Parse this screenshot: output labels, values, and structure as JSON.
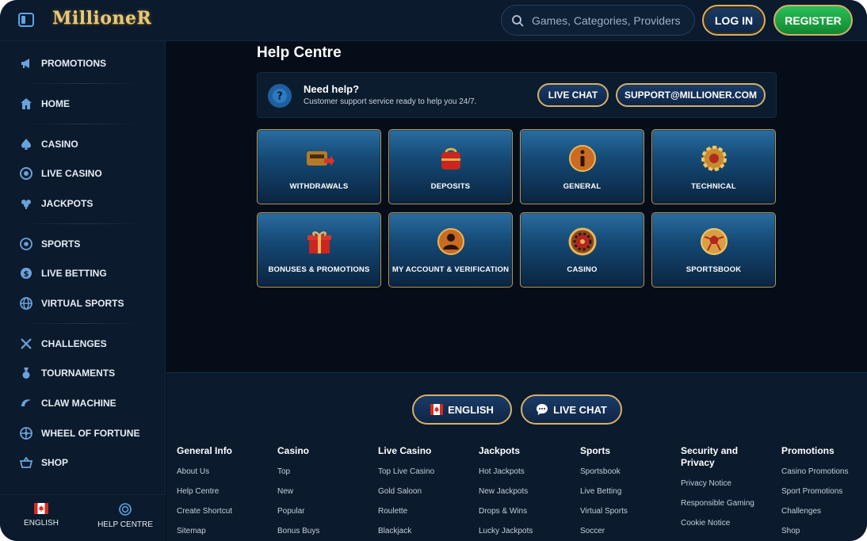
{
  "header": {
    "logo_text": "MillioneR",
    "search_placeholder": "Games, Categories, Providers",
    "login_label": "LOG IN",
    "register_label": "REGISTER"
  },
  "sidebar": {
    "items": [
      {
        "label": "PROMOTIONS",
        "icon": "megaphone-icon"
      },
      {
        "label": "HOME",
        "icon": "home-icon"
      },
      {
        "label": "CASINO",
        "icon": "spade-icon"
      },
      {
        "label": "LIVE CASINO",
        "icon": "casino-chip-icon"
      },
      {
        "label": "JACKPOTS",
        "icon": "clover-icon"
      },
      {
        "label": "SPORTS",
        "icon": "soccer-ball-icon"
      },
      {
        "label": "LIVE BETTING",
        "icon": "dollar-coin-icon"
      },
      {
        "label": "VIRTUAL SPORTS",
        "icon": "globe-icon"
      },
      {
        "label": "CHALLENGES",
        "icon": "crossed-swords-icon"
      },
      {
        "label": "TOURNAMENTS",
        "icon": "medal-icon"
      },
      {
        "label": "CLAW MACHINE",
        "icon": "claw-icon"
      },
      {
        "label": "WHEEL OF FORTUNE",
        "icon": "wheel-icon"
      },
      {
        "label": "SHOP",
        "icon": "basket-icon"
      }
    ],
    "bottom": {
      "language_label": "ENGLISH",
      "help_label": "HELP CENTRE"
    }
  },
  "main": {
    "title": "Help Centre",
    "help_bar": {
      "title": "Need help?",
      "subtitle": "Customer support service ready to help you 24/7.",
      "live_chat_label": "LIVE CHAT",
      "email_label": "SUPPORT@MILLIONER.COM"
    },
    "categories": [
      {
        "label": "WITHDRAWALS",
        "icon": "wallet-withdraw-icon"
      },
      {
        "label": "DEPOSITS",
        "icon": "bag-deposit-icon"
      },
      {
        "label": "GENERAL",
        "icon": "info-icon"
      },
      {
        "label": "TECHNICAL",
        "icon": "gear-icon"
      },
      {
        "label": "BONUSES & PROMOTIONS",
        "icon": "gift-icon"
      },
      {
        "label": "MY ACCOUNT & VERIFICATION",
        "icon": "user-icon"
      },
      {
        "label": "CASINO",
        "icon": "roulette-icon"
      },
      {
        "label": "SPORTSBOOK",
        "icon": "football-icon"
      }
    ]
  },
  "footer": {
    "language_button": "ENGLISH",
    "live_chat_button": "LIVE CHAT",
    "columns": [
      {
        "title": "General Info",
        "links": [
          "About Us",
          "Help Centre",
          "Create Shortcut",
          "Sitemap"
        ]
      },
      {
        "title": "Casino",
        "links": [
          "Top",
          "New",
          "Popular",
          "Bonus Buys"
        ]
      },
      {
        "title": "Live Casino",
        "links": [
          "Top Live Casino",
          "Gold Saloon",
          "Roulette",
          "Blackjack"
        ]
      },
      {
        "title": "Jackpots",
        "links": [
          "Hot Jackpots",
          "New Jackpots",
          "Drops & Wins",
          "Lucky Jackpots"
        ]
      },
      {
        "title": "Sports",
        "links": [
          "Sportsbook",
          "Live Betting",
          "Virtual Sports",
          "Soccer"
        ]
      },
      {
        "title": "Security and Privacy",
        "links": [
          "Privacy Notice",
          "Responsible Gaming",
          "Cookie Notice"
        ]
      },
      {
        "title": "Promotions",
        "links": [
          "Casino Promotions",
          "Sport Promotions",
          "Challenges",
          "Shop"
        ]
      }
    ]
  },
  "colors": {
    "gold_border": "#d4b06a",
    "register_green": "#1fa547",
    "background": "#07111f"
  }
}
